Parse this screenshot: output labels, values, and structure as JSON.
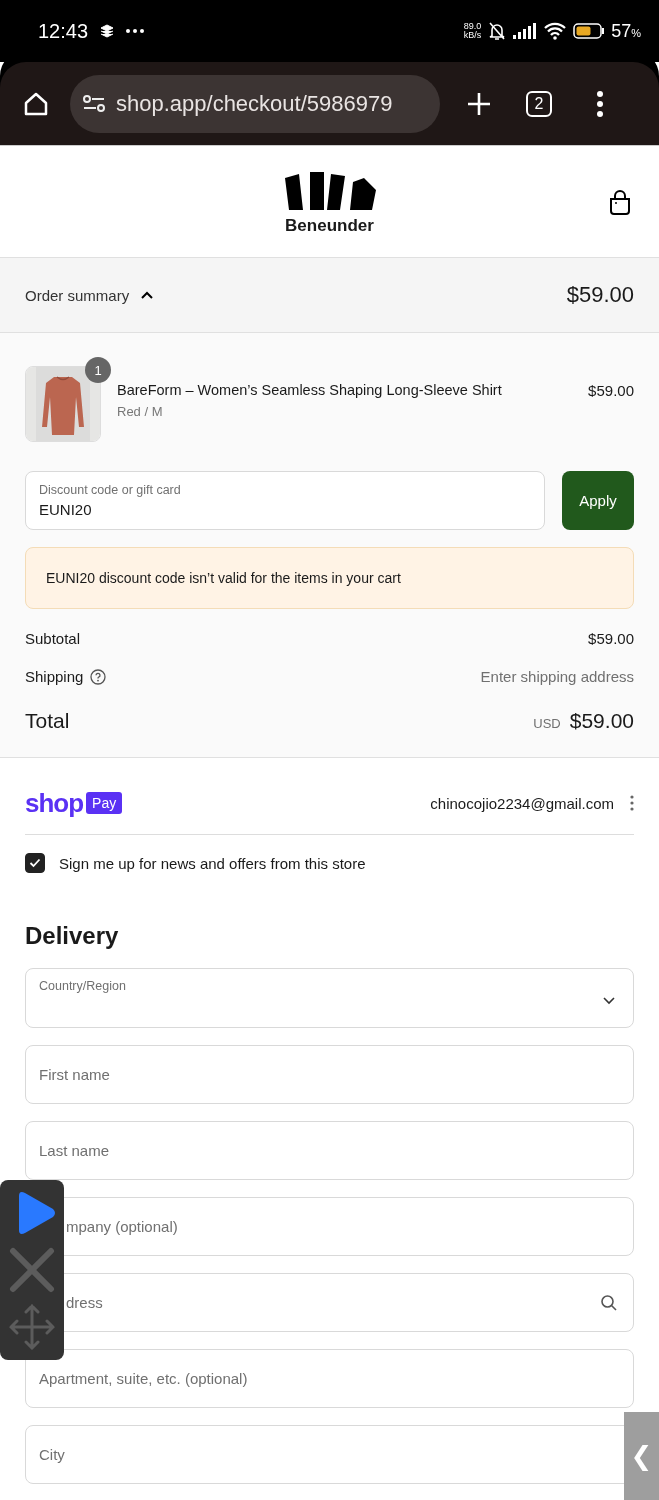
{
  "status_bar": {
    "time": "12:43",
    "net_speed": "89.0",
    "net_unit": "kB/s",
    "battery": "57",
    "battery_unit": "%"
  },
  "browser": {
    "url": "shop.app/checkout/5986979",
    "tab_count": "2"
  },
  "store": {
    "name": "Beneunder"
  },
  "order_summary": {
    "label": "Order summary",
    "expanded": true,
    "total": "$59.00"
  },
  "items": [
    {
      "name": "BareForm – Women’s Seamless Shaping Long-Sleeve Shirt",
      "variant": "Red / M",
      "price": "$59.00",
      "quantity": "1",
      "kind": "picture"
    }
  ],
  "discount": {
    "label": "Discount code or gift card",
    "value": "EUNI20",
    "button": "Apply"
  },
  "error": "EUNI20 discount code isn’t valid for the items in your cart",
  "totals": {
    "subtotal_label": "Subtotal",
    "subtotal": "$59.00",
    "shipping_label": "Shipping",
    "shipping": "Enter shipping address",
    "total_label": "Total",
    "currency": "USD",
    "total": "$59.00"
  },
  "shop_pay": {
    "brand": "shop",
    "badge": "Pay",
    "email": "chinocojio2234@gmail.com"
  },
  "newsletter": {
    "label": "Sign me up for news and offers from this store",
    "checked": true
  },
  "delivery": {
    "title": "Delivery",
    "fields": [
      {
        "kind": "select",
        "label": "Country/Region"
      },
      {
        "kind": "text",
        "placeholder": "First name"
      },
      {
        "kind": "text",
        "placeholder": "Last name"
      },
      {
        "kind": "text",
        "placeholder": "mpany (optional)"
      },
      {
        "kind": "search",
        "placeholder": "dress"
      },
      {
        "kind": "text",
        "placeholder": "Apartment, suite, etc. (optional)"
      },
      {
        "kind": "text",
        "placeholder": "City"
      }
    ]
  },
  "side_tab": "❮"
}
